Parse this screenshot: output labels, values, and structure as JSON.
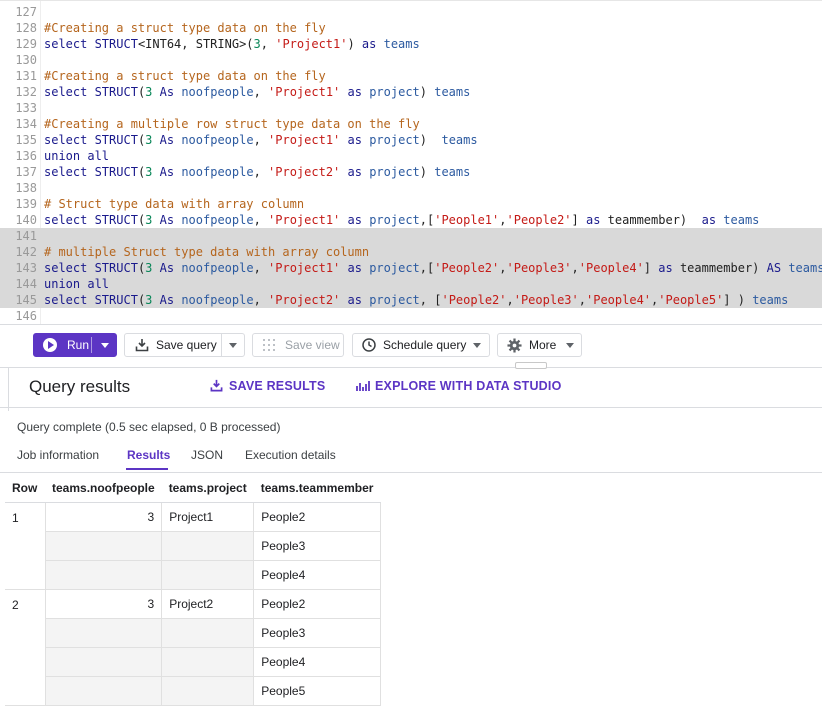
{
  "editor": {
    "lines": [
      {
        "n": "127",
        "sel": false,
        "tokens": []
      },
      {
        "n": "128",
        "sel": false,
        "tokens": [
          [
            "c",
            "#Creating a struct type data on the fly"
          ]
        ]
      },
      {
        "n": "129",
        "sel": false,
        "tokens": [
          [
            "k",
            "select "
          ],
          [
            "k",
            "STRUCT"
          ],
          [
            "p",
            "<INT64, STRING>("
          ],
          [
            "n",
            "3"
          ],
          [
            "p",
            ", "
          ],
          [
            "s",
            "'Project1'"
          ],
          [
            "p",
            ") "
          ],
          [
            "k",
            "as "
          ],
          [
            "i",
            "teams"
          ]
        ]
      },
      {
        "n": "130",
        "sel": false,
        "tokens": []
      },
      {
        "n": "131",
        "sel": false,
        "tokens": [
          [
            "c",
            "#Creating a struct type data on the fly"
          ]
        ]
      },
      {
        "n": "132",
        "sel": false,
        "tokens": [
          [
            "k",
            "select "
          ],
          [
            "k",
            "STRUCT"
          ],
          [
            "p",
            "("
          ],
          [
            "n",
            "3"
          ],
          [
            "p",
            " "
          ],
          [
            "k",
            "As "
          ],
          [
            "i",
            "noofpeople"
          ],
          [
            "p",
            ", "
          ],
          [
            "s",
            "'Project1'"
          ],
          [
            "p",
            " "
          ],
          [
            "k",
            "as "
          ],
          [
            "i",
            "project"
          ],
          [
            "p",
            ") "
          ],
          [
            "i",
            "teams"
          ]
        ]
      },
      {
        "n": "133",
        "sel": false,
        "tokens": []
      },
      {
        "n": "134",
        "sel": false,
        "tokens": [
          [
            "c",
            "#Creating a multiple row struct type data on the fly"
          ]
        ]
      },
      {
        "n": "135",
        "sel": false,
        "tokens": [
          [
            "k",
            "select "
          ],
          [
            "k",
            "STRUCT"
          ],
          [
            "p",
            "("
          ],
          [
            "n",
            "3"
          ],
          [
            "p",
            " "
          ],
          [
            "k",
            "As "
          ],
          [
            "i",
            "noofpeople"
          ],
          [
            "p",
            ", "
          ],
          [
            "s",
            "'Project1'"
          ],
          [
            "p",
            " "
          ],
          [
            "k",
            "as "
          ],
          [
            "i",
            "project"
          ],
          [
            "p",
            ")  "
          ],
          [
            "i",
            "teams"
          ]
        ]
      },
      {
        "n": "136",
        "sel": false,
        "tokens": [
          [
            "k",
            "union all"
          ]
        ]
      },
      {
        "n": "137",
        "sel": false,
        "tokens": [
          [
            "k",
            "select "
          ],
          [
            "k",
            "STRUCT"
          ],
          [
            "p",
            "("
          ],
          [
            "n",
            "3"
          ],
          [
            "p",
            " "
          ],
          [
            "k",
            "As "
          ],
          [
            "i",
            "noofpeople"
          ],
          [
            "p",
            ", "
          ],
          [
            "s",
            "'Project2'"
          ],
          [
            "p",
            " "
          ],
          [
            "k",
            "as "
          ],
          [
            "i",
            "project"
          ],
          [
            "p",
            ") "
          ],
          [
            "i",
            "teams"
          ]
        ]
      },
      {
        "n": "138",
        "sel": false,
        "tokens": []
      },
      {
        "n": "139",
        "sel": false,
        "tokens": [
          [
            "c",
            "# Struct type data with array column"
          ]
        ]
      },
      {
        "n": "140",
        "sel": false,
        "tokens": [
          [
            "k",
            "select "
          ],
          [
            "k",
            "STRUCT"
          ],
          [
            "p",
            "("
          ],
          [
            "n",
            "3"
          ],
          [
            "p",
            " "
          ],
          [
            "k",
            "As "
          ],
          [
            "i",
            "noofpeople"
          ],
          [
            "p",
            ", "
          ],
          [
            "s",
            "'Project1'"
          ],
          [
            "p",
            " "
          ],
          [
            "k",
            "as "
          ],
          [
            "i",
            "project"
          ],
          [
            "p",
            ",["
          ],
          [
            "s",
            "'People1'"
          ],
          [
            "p",
            ","
          ],
          [
            "s",
            "'People2'"
          ],
          [
            "p",
            "] "
          ],
          [
            "k",
            "as "
          ],
          [
            "p",
            "teammember)  "
          ],
          [
            "k",
            "as "
          ],
          [
            "i",
            "teams"
          ]
        ]
      },
      {
        "n": "141",
        "sel": true,
        "tokens": []
      },
      {
        "n": "142",
        "sel": true,
        "tokens": [
          [
            "c",
            "# multiple Struct type data with array column"
          ]
        ]
      },
      {
        "n": "143",
        "sel": true,
        "tokens": [
          [
            "k",
            "select "
          ],
          [
            "k",
            "STRUCT"
          ],
          [
            "p",
            "("
          ],
          [
            "n",
            "3"
          ],
          [
            "p",
            " "
          ],
          [
            "k",
            "As "
          ],
          [
            "i",
            "noofpeople"
          ],
          [
            "p",
            ", "
          ],
          [
            "s",
            "'Project1'"
          ],
          [
            "p",
            " "
          ],
          [
            "k",
            "as "
          ],
          [
            "i",
            "project"
          ],
          [
            "p",
            ",["
          ],
          [
            "s",
            "'People2'"
          ],
          [
            "p",
            ","
          ],
          [
            "s",
            "'People3'"
          ],
          [
            "p",
            ","
          ],
          [
            "s",
            "'People4'"
          ],
          [
            "p",
            "] "
          ],
          [
            "k",
            "as "
          ],
          [
            "p",
            "teammember) "
          ],
          [
            "k",
            "AS "
          ],
          [
            "i",
            "teams"
          ]
        ]
      },
      {
        "n": "144",
        "sel": true,
        "tokens": [
          [
            "k",
            "union all"
          ]
        ]
      },
      {
        "n": "145",
        "sel": true,
        "tokens": [
          [
            "k",
            "select "
          ],
          [
            "k",
            "STRUCT"
          ],
          [
            "p",
            "("
          ],
          [
            "n",
            "3"
          ],
          [
            "p",
            " "
          ],
          [
            "k",
            "As "
          ],
          [
            "i",
            "noofpeople"
          ],
          [
            "p",
            ", "
          ],
          [
            "s",
            "'Project2'"
          ],
          [
            "p",
            " "
          ],
          [
            "k",
            "as "
          ],
          [
            "i",
            "project"
          ],
          [
            "p",
            ", ["
          ],
          [
            "s",
            "'People2'"
          ],
          [
            "p",
            ","
          ],
          [
            "s",
            "'People3'"
          ],
          [
            "p",
            ","
          ],
          [
            "s",
            "'People4'"
          ],
          [
            "p",
            ","
          ],
          [
            "s",
            "'People5'"
          ],
          [
            "p",
            "] ) "
          ],
          [
            "i",
            "teams"
          ]
        ]
      },
      {
        "n": "146",
        "sel": false,
        "tokens": []
      }
    ]
  },
  "toolbar": {
    "run_label": "Run",
    "save_query_label": "Save query",
    "save_view_label": "Save view",
    "schedule_label": "Schedule query",
    "more_label": "More"
  },
  "results": {
    "title": "Query results",
    "save_results": "SAVE RESULTS",
    "explore": "EXPLORE WITH DATA STUDIO",
    "status": "Query complete (0.5 sec elapsed, 0 B processed)",
    "tabs": [
      "Job information",
      "Results",
      "JSON",
      "Execution details"
    ],
    "active_tab": "Results",
    "columns": [
      "Row",
      "teams.noofpeople",
      "teams.project",
      "teams.teammember"
    ],
    "rows": [
      {
        "row": "1",
        "noofpeople": "3",
        "project": "Project1",
        "teammember": [
          "People2",
          "People3",
          "People4"
        ]
      },
      {
        "row": "2",
        "noofpeople": "3",
        "project": "Project2",
        "teammember": [
          "People2",
          "People3",
          "People4",
          "People5"
        ]
      }
    ]
  },
  "colors": {
    "accent": "#5c35c4",
    "selection": "#d9d9d9"
  }
}
